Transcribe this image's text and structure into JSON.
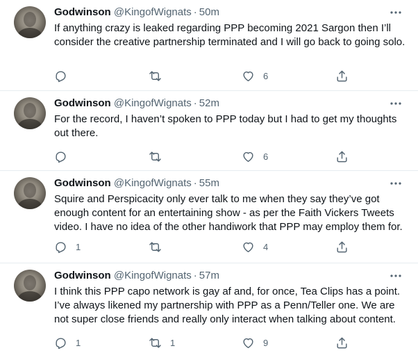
{
  "colors": {
    "text": "#0f1419",
    "secondary": "#536471",
    "divider": "#e6ecf0"
  },
  "icons": {
    "reply": "reply-icon",
    "retweet": "retweet-icon",
    "like": "like-icon",
    "share": "share-icon",
    "more": "more-icon"
  },
  "tweets": [
    {
      "name": "Godwinson",
      "handle": "@KingofWignats",
      "separator": "·",
      "time": "50m",
      "text": "If anything crazy is leaked regarding PPP becoming 2021 Sargon then I’ll consider the creative partnership terminated and I will go back to going solo.",
      "replies": "",
      "retweets": "",
      "likes": "6"
    },
    {
      "name": "Godwinson",
      "handle": "@KingofWignats",
      "separator": "·",
      "time": "52m",
      "text": "For the record, I haven’t spoken to PPP today but I had to get my thoughts out there.",
      "replies": "",
      "retweets": "",
      "likes": "6"
    },
    {
      "name": "Godwinson",
      "handle": "@KingofWignats",
      "separator": "·",
      "time": "55m",
      "text": "Squire and Perspicacity only ever talk to me when they say they’ve got enough content for an entertaining show - as per the Faith Vickers Tweets video. I have no idea of the other handiwork that PPP may employ them for.",
      "replies": "1",
      "retweets": "",
      "likes": "4"
    },
    {
      "name": "Godwinson",
      "handle": "@KingofWignats",
      "separator": "·",
      "time": "57m",
      "text": "I think this PPP capo network is gay af and, for once, Tea Clips has a point. I’ve always likened my partnership with PPP as a Penn/Teller one. We are not super close friends and really only interact when talking about content.",
      "replies": "1",
      "retweets": "1",
      "likes": "9"
    }
  ]
}
